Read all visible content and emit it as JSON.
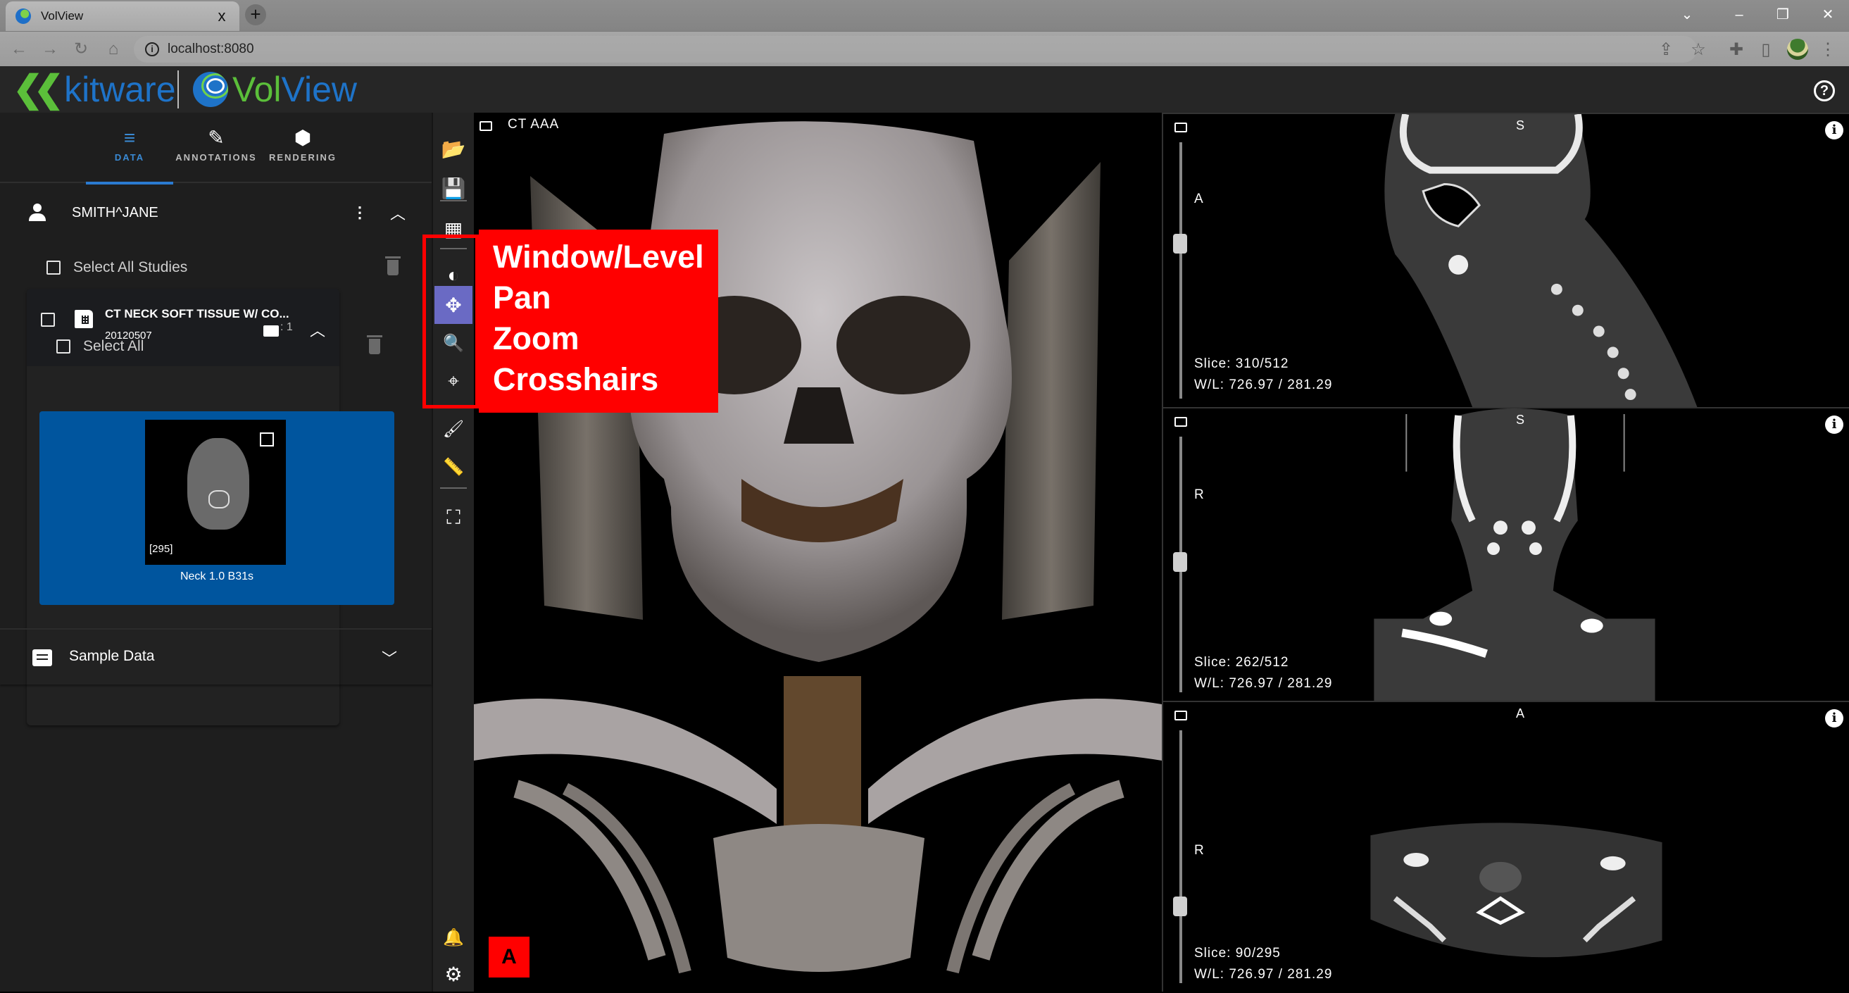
{
  "browser": {
    "tab_title": "VolView",
    "tab_close": "x",
    "new_tab": "+",
    "url": "localhost:8080",
    "window_controls": {
      "dropdown": "⌄",
      "minimize": "–",
      "restore": "❐",
      "close": "✕"
    },
    "nav": {
      "back": "←",
      "forward": "→",
      "reload": "↻",
      "home": "⌂"
    },
    "icons": {
      "share": "⇪",
      "bookmark": "☆",
      "extensions": "✚",
      "sidepanel": "▯",
      "menu": "⋮"
    }
  },
  "app": {
    "brand_left": "kitware",
    "brand_right_a": "Vol",
    "brand_right_b": "View",
    "help_label": "?",
    "colors": {
      "kitware_blue": "#1e73c8",
      "kitware_green": "#5bbf3a",
      "selected_series": "#00559e",
      "active_tool": "#6a6ac4",
      "active_tab": "#3a8ad4"
    }
  },
  "sidebar": {
    "tabs": [
      {
        "label": "DATA",
        "icon": "database-icon",
        "active": true
      },
      {
        "label": "ANNOTATIONS",
        "icon": "pencil-icon",
        "active": false
      },
      {
        "label": "RENDERING",
        "icon": "cube-icon",
        "active": false
      }
    ],
    "patient": {
      "name": "SMITH^JANE",
      "menu": "⋮",
      "expand": "︿"
    },
    "select_all_studies": "Select All Studies",
    "study": {
      "title": "CT NECK SOFT TISSUE W/ CO...",
      "date": "20120507",
      "series_count": ": 1",
      "expand": "︿"
    },
    "select_all": "Select All",
    "series": [
      {
        "name": "Neck 1.0 B31s",
        "slice_count": "[295]",
        "selected": true
      }
    ],
    "sample_data": {
      "label": "Sample Data",
      "expand": "﹀"
    }
  },
  "toolbar": {
    "tools": [
      {
        "name": "open-files",
        "glyph": "📂"
      },
      {
        "name": "save-session",
        "glyph": "💾"
      },
      {
        "name": "layout",
        "glyph": "▦"
      },
      {
        "name": "window-level",
        "glyph": "◐"
      },
      {
        "name": "pan",
        "glyph": "✥",
        "active": true
      },
      {
        "name": "zoom",
        "glyph": "🔍"
      },
      {
        "name": "crosshairs",
        "glyph": "⌖"
      },
      {
        "name": "paint",
        "glyph": "🖌"
      },
      {
        "name": "ruler",
        "glyph": "📏"
      },
      {
        "name": "crop",
        "glyph": "⛶"
      },
      {
        "name": "notifications",
        "glyph": "🔔"
      },
      {
        "name": "settings",
        "glyph": "⚙"
      }
    ]
  },
  "views": {
    "volume": {
      "label": "CT AAA"
    },
    "slices": [
      {
        "name": "sagittal",
        "top_label": "S",
        "side_label": "A",
        "slice": "Slice: 310/512",
        "wl": "W/L: 726.97 / 281.29",
        "slice_index": 310,
        "slice_total": 512
      },
      {
        "name": "coronal",
        "top_label": "S",
        "side_label": "R",
        "slice": "Slice: 262/512",
        "wl": "W/L: 726.97 / 281.29",
        "slice_index": 262,
        "slice_total": 512
      },
      {
        "name": "axial",
        "top_label": "A",
        "side_label": "R",
        "slice": "Slice: 90/295",
        "wl": "W/L: 726.97 / 281.29",
        "slice_index": 90,
        "slice_total": 295
      }
    ],
    "info_label": "i"
  },
  "annotation": {
    "callout_lines": [
      "Window/Level",
      "Pan",
      "Zoom",
      "Crosshairs"
    ],
    "badge": "A",
    "color": "#ff0000"
  }
}
